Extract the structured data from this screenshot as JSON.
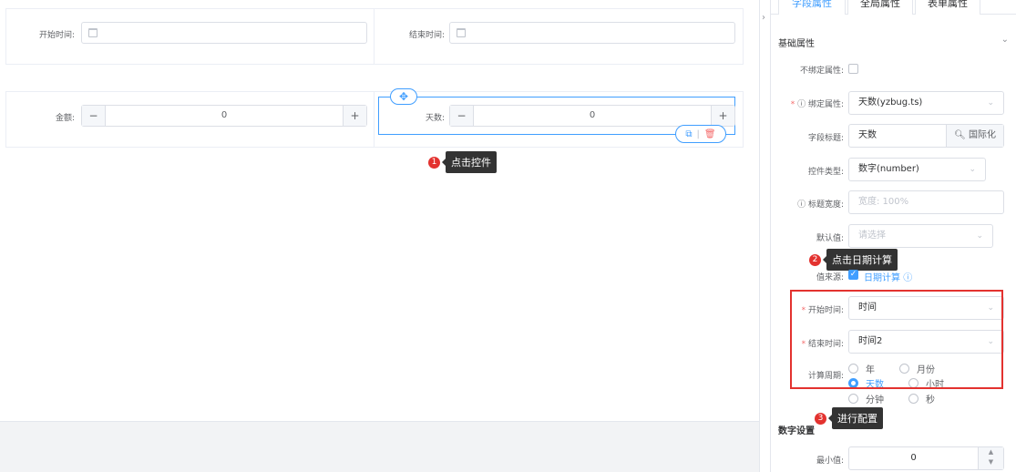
{
  "canvas": {
    "row1": {
      "start_label": "开始时间:",
      "end_label": "结束时间:"
    },
    "row2": {
      "amount_label": "金额:",
      "amount_value": "0",
      "days_label": "天数:",
      "days_value": "0",
      "minus": "−",
      "plus": "+"
    },
    "callouts": [
      {
        "num": "1",
        "text": "点击控件"
      },
      {
        "num": "2",
        "text": "点击日期计算"
      },
      {
        "num": "3",
        "text": "进行配置"
      }
    ]
  },
  "panel": {
    "tabs": [
      "字段属性",
      "全局属性",
      "表单属性"
    ],
    "basic_section": "基础属性",
    "unbound_label": "不绑定属性:",
    "bind_label": "绑定属性:",
    "bind_value": "天数(yzbug.ts)",
    "field_title_label": "字段标题:",
    "field_title_value": "天数",
    "i18n_label": "国际化",
    "control_type_label": "控件类型:",
    "control_type_value": "数字(number)",
    "title_width_label": "标题宽度:",
    "title_width_placeholder": "宽度: 100%",
    "default_label": "默认值:",
    "default_placeholder": "请选择",
    "source_label": "值来源:",
    "date_calc_label": "日期计算",
    "start_time_label": "开始时间:",
    "start_time_value": "时间",
    "end_time_label": "结束时间:",
    "end_time_value": "时间2",
    "period_label": "计算周期:",
    "period_options": [
      "年",
      "月份",
      "天数",
      "小时",
      "分钟",
      "秒"
    ],
    "period_selected": "天数",
    "number_section": "数字设置",
    "min_label": "最小值:",
    "min_value": "0"
  },
  "colors": {
    "accent": "#409eff",
    "callout_red": "#e3322f",
    "tooltip_bg": "#333333"
  }
}
